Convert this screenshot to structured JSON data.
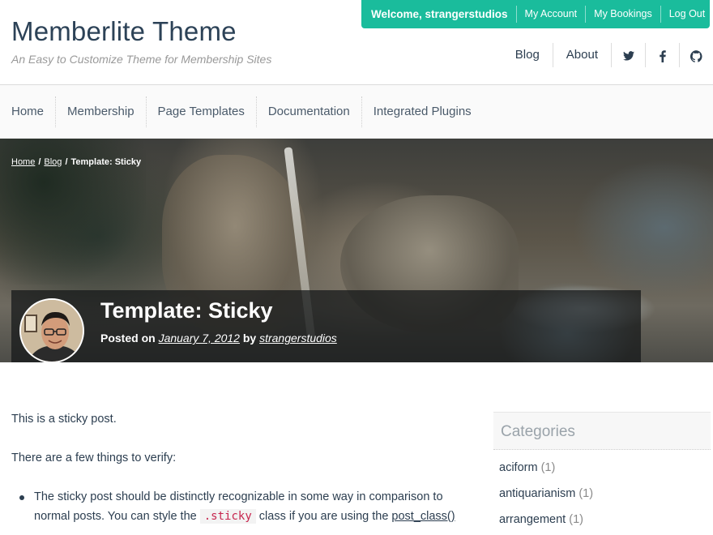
{
  "site": {
    "title": "Memberlite Theme",
    "description": "An Easy to Customize Theme for Membership Sites"
  },
  "member_bar": {
    "welcome": "Welcome, strangerstudios",
    "my_account": "My Account",
    "my_bookings": "My Bookings",
    "log_out": "Log Out",
    "color": "#1abc9c"
  },
  "secondary_nav": {
    "items": [
      "Blog",
      "About"
    ],
    "icons": [
      "twitter-icon",
      "facebook-icon",
      "github-icon"
    ]
  },
  "main_nav": {
    "items": [
      "Home",
      "Membership",
      "Page Templates",
      "Documentation",
      "Integrated Plugins"
    ]
  },
  "breadcrumb": {
    "home": "Home",
    "blog": "Blog",
    "current": "Template: Sticky",
    "separator": "/"
  },
  "entry": {
    "title": "Template: Sticky",
    "posted_on": "Posted on",
    "date": "January 7, 2012",
    "by": "by",
    "author": "strangerstudios"
  },
  "content": {
    "p1": "This is a sticky post.",
    "p2": "There are a few things to verify:",
    "li1_a": "The sticky post should be distinctly recognizable in some way in comparison to normal posts. You can style the",
    "li1_code": ".sticky",
    "li1_b": "class if you are using the",
    "li1_link": "post_class()"
  },
  "sidebar": {
    "title": "Categories",
    "categories": [
      {
        "name": "aciform",
        "count": "(1)"
      },
      {
        "name": "antiquarianism",
        "count": "(1)"
      },
      {
        "name": "arrangement",
        "count": "(1)"
      }
    ]
  }
}
